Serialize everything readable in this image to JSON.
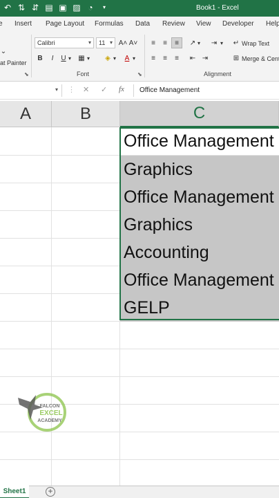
{
  "window": {
    "title": "Book1  -  Excel"
  },
  "ribbon_tabs": [
    "Insert",
    "Page Layout",
    "Formulas",
    "Data",
    "Review",
    "View",
    "Developer",
    "Help"
  ],
  "home_tab_fragment": "e",
  "clipboard": {
    "format_painter_label": "at Painter"
  },
  "font": {
    "name": "Calibri",
    "size": "11",
    "group_label": "Font",
    "grow_label": "A˄",
    "shrink_label": "A˅",
    "bold": "B",
    "italic": "I",
    "underline": "U"
  },
  "alignment": {
    "wrap_text_label": "Wrap Text",
    "merge_label": "Merge & Cent",
    "group_label": "Alignment"
  },
  "formula_bar": {
    "cancel_glyph": "✕",
    "enter_glyph": "✓",
    "fx_label": "fx",
    "value": "Office Management"
  },
  "columns": [
    {
      "label": "A",
      "active": false
    },
    {
      "label": "B",
      "active": false
    },
    {
      "label": "C",
      "active": true
    }
  ],
  "cells_c": [
    "Office Management",
    "Graphics",
    "Office Management",
    "Graphics",
    "Accounting",
    "Office Management",
    "GELP"
  ],
  "watermark": {
    "line1": "FALCON",
    "line2": "EXCEL",
    "line3": "ACADEMY"
  },
  "sheets": {
    "active": "Sheet1",
    "add_glyph": "+"
  },
  "colors": {
    "excel_green": "#217346",
    "selection_gray": "#c6c6c6"
  }
}
